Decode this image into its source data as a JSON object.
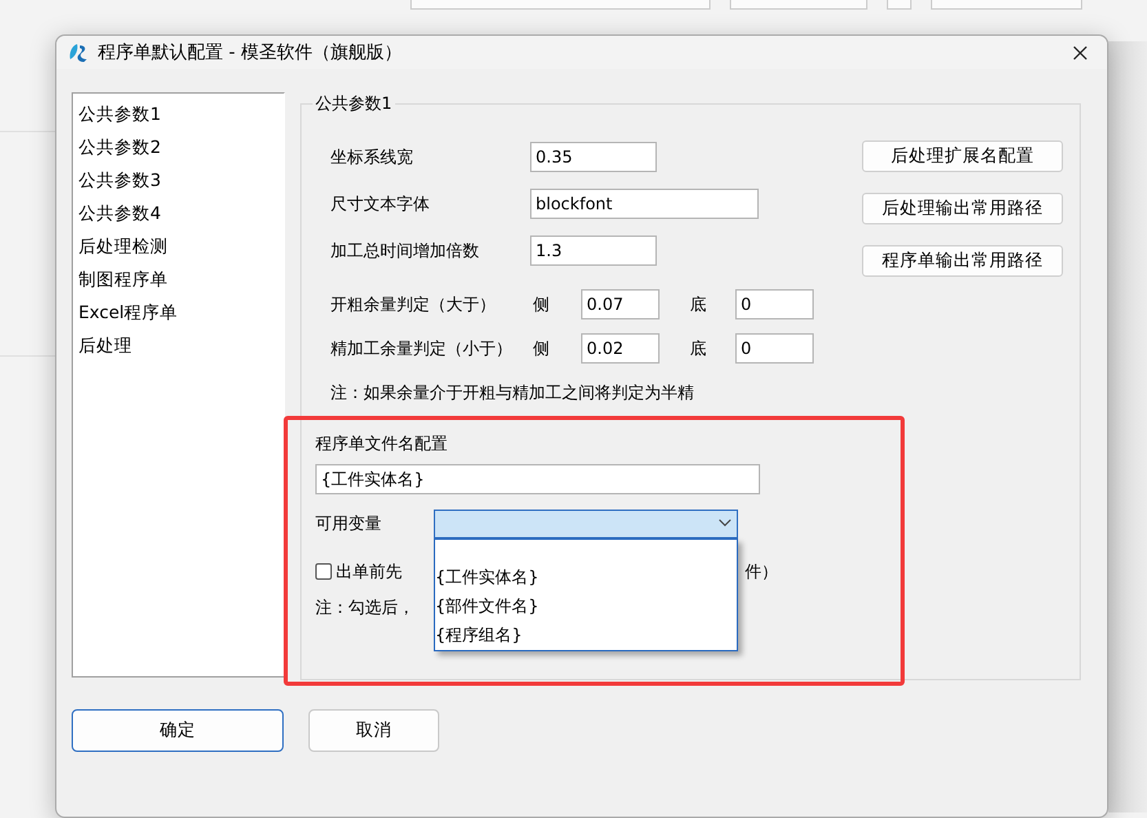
{
  "window": {
    "title": "程序单默认配置 - 模圣软件（旗舰版）"
  },
  "nav_list": {
    "items": [
      {
        "label": "公共参数1"
      },
      {
        "label": "公共参数2"
      },
      {
        "label": "公共参数3"
      },
      {
        "label": "公共参数4"
      },
      {
        "label": "后处理检测"
      },
      {
        "label": "制图程序单"
      },
      {
        "label": "Excel程序单"
      },
      {
        "label": "后处理"
      }
    ]
  },
  "group": {
    "title": "公共参数1",
    "fields": [
      {
        "label": "坐标系线宽",
        "value": "0.35"
      },
      {
        "label": "尺寸文本字体",
        "value": "blockfont"
      },
      {
        "label": "加工总时间增加倍数",
        "value": "1.3"
      }
    ],
    "allowances": [
      {
        "label": "开粗余量判定（大于）",
        "side_label": "侧",
        "side_value": "0.07",
        "bottom_label": "底",
        "bottom_value": "0"
      },
      {
        "label": "精加工余量判定（小于）",
        "side_label": "侧",
        "side_value": "0.02",
        "bottom_label": "底",
        "bottom_value": "0"
      }
    ],
    "note": "注：如果余量介于开粗与精加工之间将判定为半精",
    "side_buttons": [
      "后处理扩展名配置",
      "后处理输出常用路径",
      "程序单输出常用路径"
    ],
    "filename": {
      "label": "程序单文件名配置",
      "value": "{工件实体名}",
      "variables_label": "可用变量",
      "dropdown": {
        "focused": true,
        "expanded": true,
        "options": [
          "{工件实体名}",
          "{部件文件名}",
          "{程序组名}"
        ]
      },
      "checkbox": {
        "label_start": "出单前先",
        "label_end": "件）",
        "checked": false
      },
      "note": "注：勾选后，"
    }
  },
  "annotation": {
    "kind": "rectangle"
  },
  "buttons": [
    {
      "label": "确定",
      "default": true
    },
    {
      "label": "取消",
      "default": false
    }
  ]
}
